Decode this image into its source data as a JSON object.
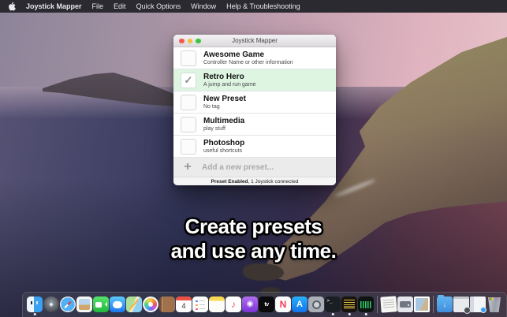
{
  "menu_bar": {
    "app_name": "Joystick Mapper",
    "menus": [
      "File",
      "Edit",
      "Quick Options",
      "Window",
      "Help & Troubleshooting"
    ]
  },
  "window": {
    "title": "Joystick Mapper",
    "presets": [
      {
        "name": "Awesome Game",
        "tag": "Controller Name or other information",
        "checked": false
      },
      {
        "name": "Retro Hero",
        "tag": "A jump and run game",
        "checked": true,
        "check_glyph": "✓"
      },
      {
        "name": "New Preset",
        "tag": "No tag",
        "checked": false
      },
      {
        "name": "Multimedia",
        "tag": "play stuff",
        "checked": false
      },
      {
        "name": "Photoshop",
        "tag": "useful shortcuts",
        "checked": false
      }
    ],
    "add_row": {
      "label": "Add a new preset..."
    },
    "status": {
      "enabled_bold": "Preset Enabled",
      "connected_rest": ", 1 Joystick connected"
    }
  },
  "caption": {
    "line1": "Create presets",
    "line2": "and use any time."
  },
  "icons": {
    "plus": "+",
    "check": "✓"
  },
  "colors": {
    "menu_bar_bg": "#2b2a30",
    "selected_row_green": "#ddf5e1",
    "traffic_red": "#f35a52",
    "traffic_yellow": "#f8bc3c",
    "traffic_green": "#3fc33f"
  },
  "dock": {
    "items": [
      {
        "name": "finder",
        "type": "app",
        "running": true
      },
      {
        "name": "launchpad",
        "type": "app",
        "glyph": "◆"
      },
      {
        "name": "safari",
        "type": "app"
      },
      {
        "name": "preview",
        "type": "app"
      },
      {
        "name": "facetime",
        "type": "app"
      },
      {
        "name": "messages",
        "type": "app"
      },
      {
        "name": "maps",
        "type": "app"
      },
      {
        "name": "photos",
        "type": "app"
      },
      {
        "name": "contacts",
        "type": "app"
      },
      {
        "name": "calendar",
        "type": "app",
        "badge": "4"
      },
      {
        "name": "reminders",
        "type": "app"
      },
      {
        "name": "notes",
        "type": "app"
      },
      {
        "name": "music",
        "type": "app",
        "glyph": "♪"
      },
      {
        "name": "podcasts",
        "type": "app",
        "glyph": "◉"
      },
      {
        "name": "tv",
        "type": "app",
        "glyph": "tv"
      },
      {
        "name": "news",
        "type": "app",
        "glyph": "N"
      },
      {
        "name": "app-store",
        "type": "app",
        "glyph": "A"
      },
      {
        "name": "system-preferences",
        "type": "app"
      },
      {
        "name": "terminal",
        "type": "app",
        "glyph": ">_",
        "running": true
      },
      {
        "name": "monitor-app",
        "type": "app",
        "running": true
      },
      {
        "name": "activity-monitor",
        "type": "app",
        "running": true
      },
      {
        "type": "separator"
      },
      {
        "name": "document",
        "type": "file"
      },
      {
        "name": "disk-utility",
        "type": "app"
      },
      {
        "name": "screenshot-file",
        "type": "file"
      },
      {
        "type": "separator"
      },
      {
        "name": "downloads-folder",
        "type": "folder",
        "glyph": "↓"
      },
      {
        "name": "minimized-window-prefs",
        "type": "window"
      },
      {
        "name": "minimized-window-finder",
        "type": "window"
      },
      {
        "name": "trash",
        "type": "app"
      }
    ]
  }
}
